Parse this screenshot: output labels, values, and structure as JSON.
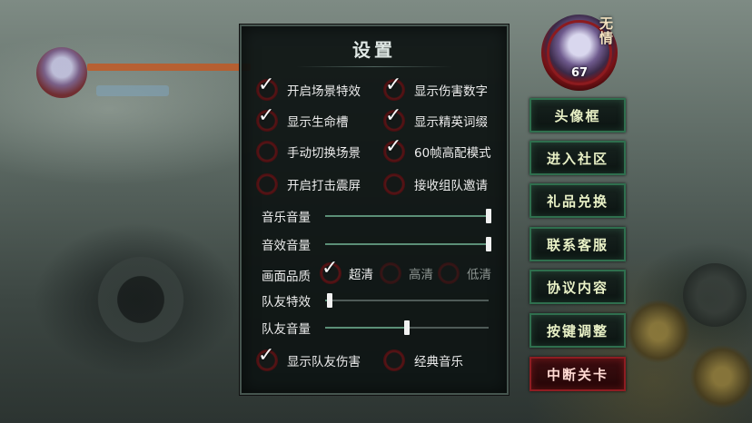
{
  "panel": {
    "title": "设置"
  },
  "options": {
    "scene_effects": {
      "label": "开启场景特效",
      "checked": true
    },
    "damage_numbers": {
      "label": "显示伤害数字",
      "checked": true
    },
    "health_slots": {
      "label": "显示生命槽",
      "checked": true
    },
    "elite_affix": {
      "label": "显示精英词缀",
      "checked": true
    },
    "manual_scene": {
      "label": "手动切换场景",
      "checked": false
    },
    "fps60": {
      "label": "60帧高配模式",
      "checked": true
    },
    "hit_shake": {
      "label": "开启打击震屏",
      "checked": false
    },
    "team_invite": {
      "label": "接收组队邀请",
      "checked": false
    },
    "team_damage": {
      "label": "显示队友伤害",
      "checked": true
    },
    "classic_music": {
      "label": "经典音乐",
      "checked": false
    }
  },
  "sliders": {
    "music_volume": {
      "label": "音乐音量",
      "value": 1.0
    },
    "sfx_volume": {
      "label": "音效音量",
      "value": 1.0
    },
    "team_effects": {
      "label": "队友特效",
      "value": 0.03
    },
    "team_volume": {
      "label": "队友音量",
      "value": 0.5
    }
  },
  "quality": {
    "label": "画面品质",
    "options": [
      "超清",
      "高清",
      "低清"
    ],
    "selected": "超清"
  },
  "side_buttons": {
    "avatar_frame": "头像框",
    "community": "进入社区",
    "gift_redeem": "礼品兑换",
    "support": "联系客服",
    "agreement": "协议内容",
    "key_binding": "按键调整",
    "abort_stage": "中断关卡"
  },
  "avatar": {
    "name": "无情",
    "level": "67"
  },
  "colors": {
    "accent_green": "#2f6f4e",
    "danger_red": "#8e1d22",
    "ring_red": "#5a1416",
    "slider_fill": "#5b8f77"
  }
}
